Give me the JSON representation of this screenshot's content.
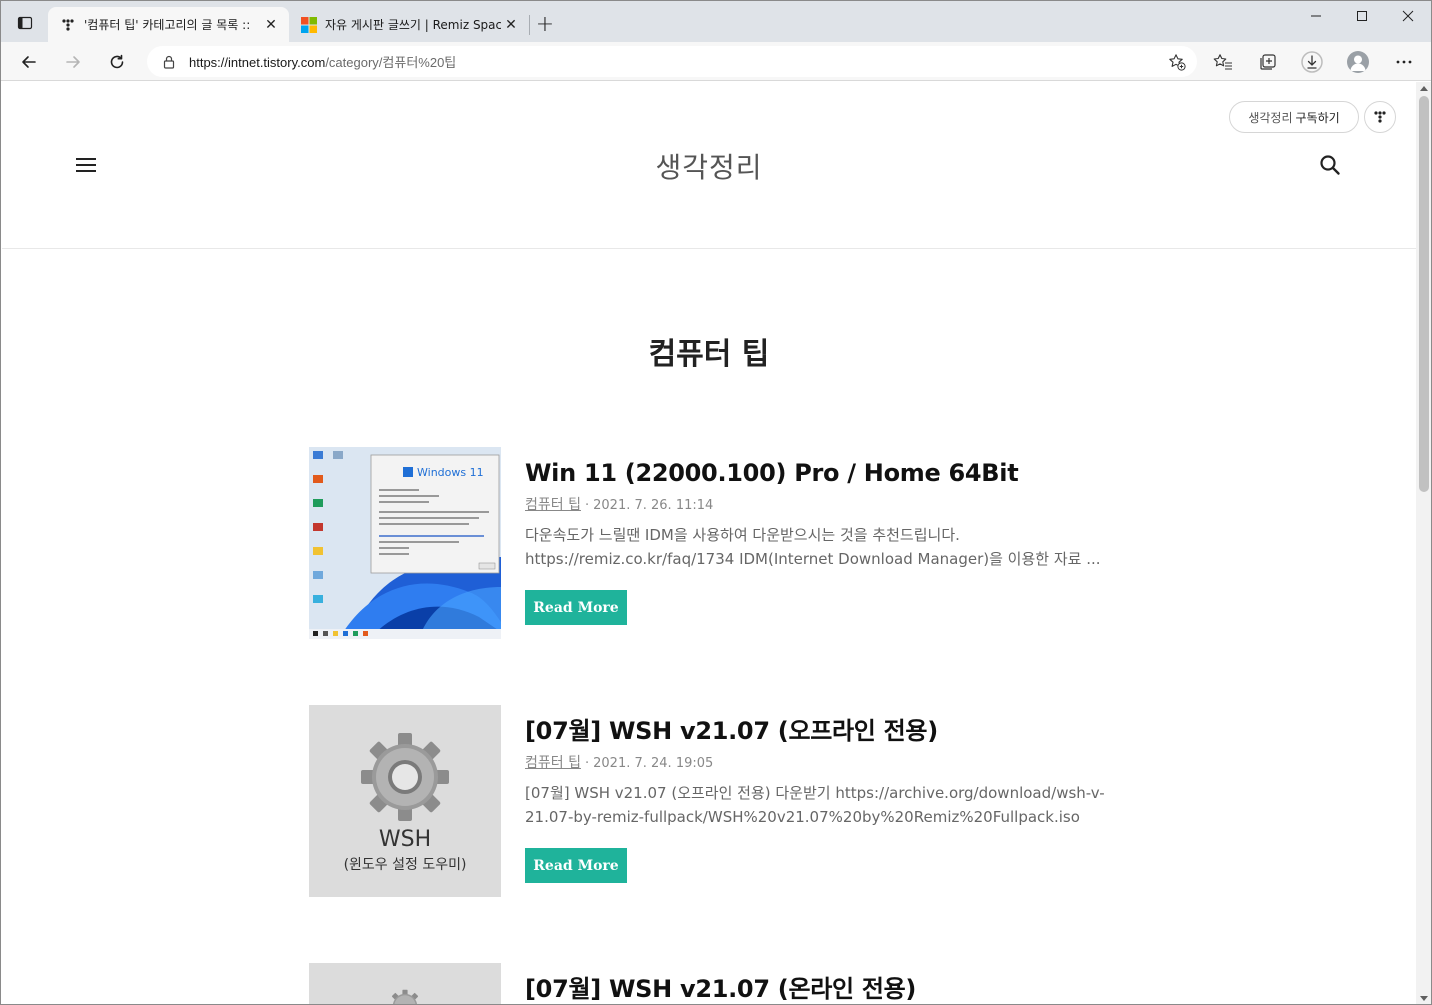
{
  "browser": {
    "tabs": [
      {
        "title": "'컴퓨터 팁' 카테고리의 글 목록 ::",
        "active": true,
        "icon": "tistory-icon"
      },
      {
        "title": "자유 게시판 글쓰기 | Remiz Space",
        "active": false,
        "icon": "microsoft-icon"
      }
    ],
    "url_host": "https://intnet.tistory.com",
    "url_path": "/category/컴퓨터%20팁",
    "new_tab_label": "+",
    "close_label": "✕"
  },
  "page": {
    "subscribe_prefix": "생각정리",
    "subscribe_action": "구독하기",
    "blog_title": "생각정리",
    "category_title": "컴퓨터 팁",
    "read_more": "Read More",
    "posts": [
      {
        "title": "Win 11 (22000.100) Pro / Home 64Bit",
        "category": "컴퓨터 팁",
        "date": "2021. 7. 26. 11:14",
        "excerpt": "다운속도가 느릴땐 IDM을 사용하여 다운받으시는 것을 추천드립니다. https://remiz.co.kr/faq/1734 IDM(Internet Download Manager)을 이용한 자료 ...",
        "thumb_label": "Windows 11"
      },
      {
        "title": "[07월] WSH v21.07 (오프라인 전용)",
        "category": "컴퓨터 팁",
        "date": "2021. 7. 24. 19:05",
        "excerpt": "[07월] WSH v21.07 (오프라인 전용) 다운받기 https://archive.org/download/wsh-v-21.07-by-remiz-fullpack/WSH%20v21.07%20by%20Remiz%20Fullpack.iso 다...",
        "thumb_label": "WSH",
        "thumb_sub": "(윈도우 설정 도우미)"
      },
      {
        "title": "[07월] WSH v21.07 (온라인 전용)"
      }
    ]
  },
  "colors": {
    "accent": "#1fb39b",
    "tabstrip": "#dfe3e8"
  }
}
